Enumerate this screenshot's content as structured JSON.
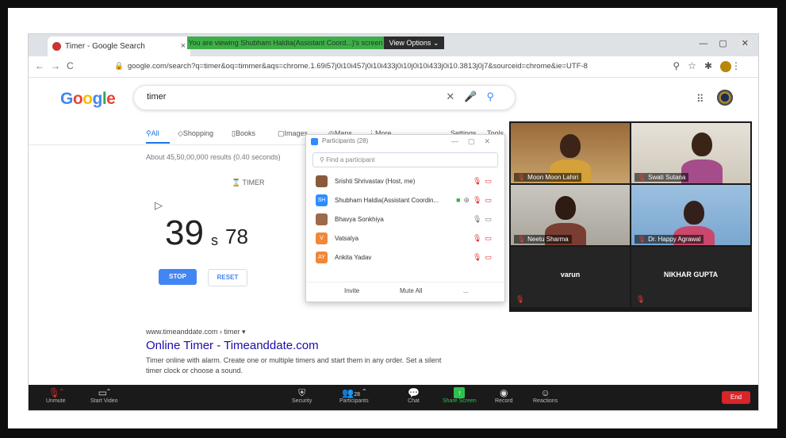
{
  "browser": {
    "tab_title": "Timer - Google Search",
    "share_banner": "You are viewing Shubham Haldia(Assistant Coord...)'s screen",
    "view_options": "View Options ⌄",
    "url": "google.com/search?q=timer&oq=timmer&aqs=chrome.1.69i57j0i10i457j0i10i433j0i10j0i10i433j0i10.3813j0j7&sourceid=chrome&ie=UTF-8"
  },
  "google": {
    "query": "timer",
    "tabs": [
      "All",
      "Shopping",
      "Books",
      "Images",
      "Maps",
      "More",
      "Settings",
      "Tools"
    ],
    "stats": "About 45,50,00,000 results (0.40 seconds)",
    "timer": {
      "label": "TIMER",
      "seconds": "39",
      "seconds_unit": "s",
      "centis": "78",
      "stop_label": "STOP",
      "reset_label": "RESET"
    },
    "result": {
      "url": "www.timeanddate.com › timer ▾",
      "title": "Online Timer - Timeanddate.com",
      "snippet1": "Timer online with alarm. Create one or multiple timers and start them in any order. Set a silent",
      "snippet2": "timer clock or choose a sound."
    }
  },
  "participants_panel": {
    "title": "Participants (28)",
    "search_placeholder": "Find a participant",
    "rows": [
      {
        "name": "Srishti Shrivastav (Host, me)",
        "initials": "",
        "color": "#8a5a3c"
      },
      {
        "name": "Shubham Haldia(Assistant Coordin...",
        "initials": "SH",
        "color": "#2d8cff"
      },
      {
        "name": "Bhavya Sonkhiya",
        "initials": "",
        "color": "#9b6b4a"
      },
      {
        "name": "Vatsalya",
        "initials": "V",
        "color": "#f0883a"
      },
      {
        "name": "Ankita Yadav",
        "initials": "AY",
        "color": "#f0883a"
      }
    ],
    "invite_label": "Invite",
    "mute_all_label": "Mute All",
    "more_label": "..."
  },
  "video_tiles": [
    {
      "name": "Moon Moon Lahiri"
    },
    {
      "name": "Swati Sutana"
    },
    {
      "name": "Neetu Sharma"
    },
    {
      "name": "Dr. Happy Agrawal"
    },
    {
      "name": "varun"
    },
    {
      "name": "NIKHAR GUPTA"
    }
  ],
  "zoom_toolbar": {
    "unmute": "Unmute",
    "start_video": "Start Video",
    "security": "Security",
    "participants": "Participants",
    "participants_count": "28",
    "chat": "Chat",
    "share_screen": "Share Screen",
    "record": "Record",
    "reactions": "Reactions",
    "end": "End"
  }
}
